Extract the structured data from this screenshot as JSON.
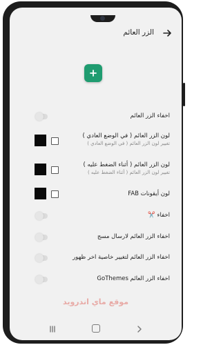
{
  "appbar": {
    "title": "الزر العائم"
  },
  "fab": {
    "color": "#1f9c70",
    "icon": "plus-icon"
  },
  "settings": [
    {
      "title": "اخفاء الزر العائم",
      "control": "toggle"
    },
    {
      "title": "لون الزر العائم ( في الوضع العادي )",
      "subtitle": "تغيير لون الزر العائم ( في الوضع العادي )",
      "control": "color"
    },
    {
      "title": "لون الزر العائم ( أثناء الضغط عليه )",
      "subtitle": "تغيير لون الزر العائم ( أثناء الضغط عليه )",
      "control": "color"
    },
    {
      "title": "لون أيقونات FAB",
      "control": "color"
    },
    {
      "title": "اخفاء ✂️",
      "control": "toggle"
    },
    {
      "title": "اخفاء الزر العائم لارسال مسج",
      "control": "toggle"
    },
    {
      "title": "اخفاء الزر العائم لتغيير خاصية اخر ظهور",
      "control": "toggle"
    },
    {
      "title": "اخفاء الزر العائم GoThemes",
      "control": "toggle"
    }
  ],
  "watermark": "موقع ماي اندرويد",
  "navbar": {
    "recents": "recents-icon",
    "home": "home-icon",
    "back": "back-nav-icon"
  }
}
